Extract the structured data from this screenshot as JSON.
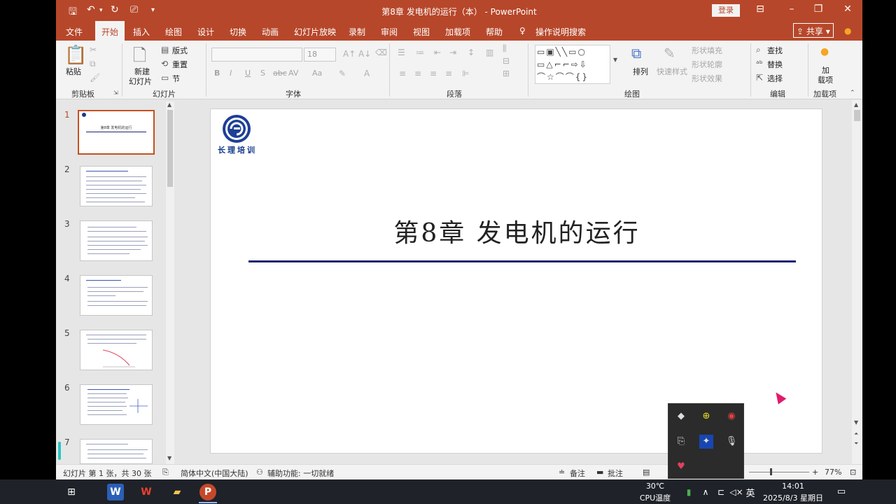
{
  "window": {
    "title": "第8章 发电机的运行（本） - PowerPoint",
    "login_label": "登录",
    "share_label": "共享",
    "tell_me": "操作说明搜索"
  },
  "qat": {
    "save_icon": "save-icon",
    "undo_icon": "undo-icon",
    "redo_icon": "redo-icon"
  },
  "tabs": [
    "文件",
    "开始",
    "插入",
    "绘图",
    "设计",
    "切换",
    "动画",
    "幻灯片放映",
    "录制",
    "审阅",
    "视图",
    "加载项",
    "帮助"
  ],
  "active_tab": "开始",
  "ribbon": {
    "clipboard": {
      "group": "剪贴板",
      "paste": "粘贴"
    },
    "slides": {
      "group": "幻灯片",
      "new_slide_1": "新建",
      "new_slide_2": "幻灯片",
      "layout": "版式",
      "reset": "重置",
      "section": "节"
    },
    "font": {
      "group": "字体",
      "size_value": "18",
      "bold": "B",
      "italic": "I",
      "underline": "U",
      "shadow": "S",
      "strike": "abc",
      "spacing": "AV",
      "case": "Aa"
    },
    "paragraph": {
      "group": "段落"
    },
    "drawing": {
      "group": "绘图",
      "arrange": "排列",
      "quick_styles": "快速样式",
      "shape_fill": "形状填充",
      "shape_outline": "形状轮廓",
      "shape_effect": "形状效果"
    },
    "editing": {
      "group": "编辑",
      "find": "查找",
      "replace": "替换",
      "select": "选择"
    },
    "addins": {
      "group": "加载项",
      "label_1": "加",
      "label_2": "载项"
    }
  },
  "thumbnails": [
    "1",
    "2",
    "3",
    "4",
    "5",
    "6",
    "7"
  ],
  "slide": {
    "title": "第8章  发电机的运行",
    "logo_text": "长理培训",
    "thumb_title": "第8章  发电机的运行"
  },
  "status": {
    "slide_info": "幻灯片 第 1 张，共 30 张",
    "language": "简体中文(中国大陆)",
    "accessibility": "辅助功能: 一切就绪",
    "notes": "备注",
    "comments": "批注",
    "zoom": "77%"
  },
  "taskbar": {
    "temp": "30℃",
    "temp_label": "CPU温度",
    "ime": "英",
    "time": "14:01",
    "date": "2025/8/3 星期日"
  },
  "colors": {
    "accent": "#b7472a",
    "slide_line": "#1c2472"
  }
}
